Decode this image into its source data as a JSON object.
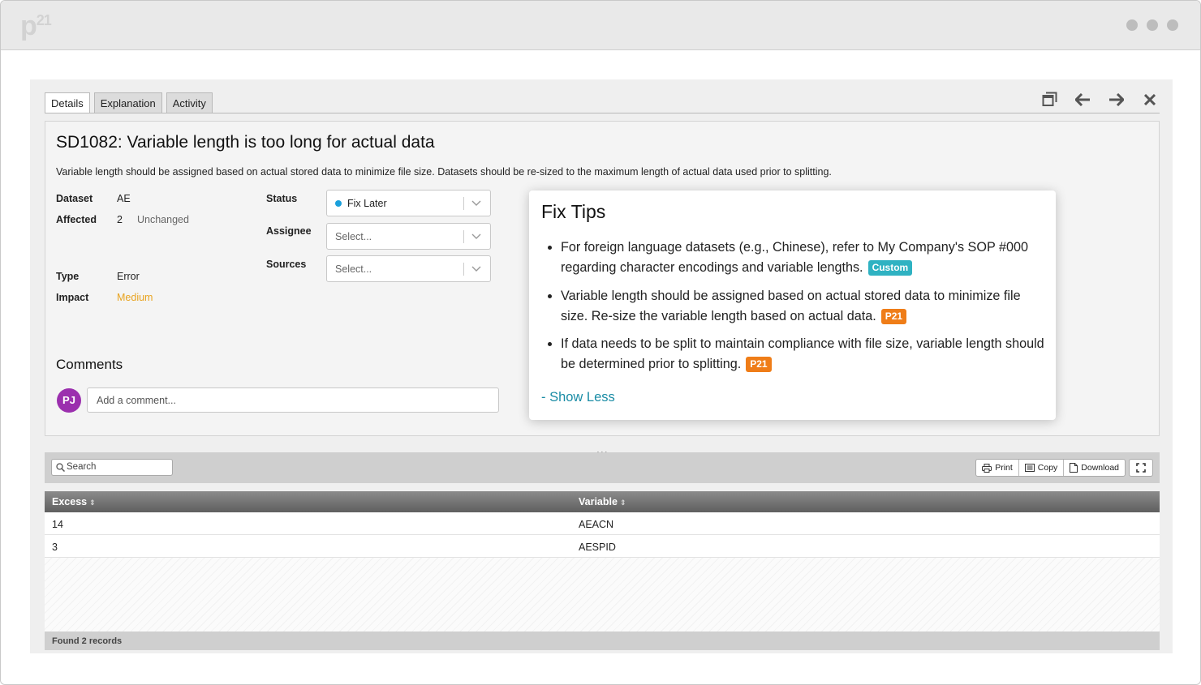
{
  "window": {
    "logo": "p",
    "logo_sup": "21"
  },
  "tabs": [
    {
      "label": "Details",
      "active": true
    },
    {
      "label": "Explanation",
      "active": false
    },
    {
      "label": "Activity",
      "active": false
    }
  ],
  "toolbar_icons": [
    "popout-icon",
    "arrow-left-icon",
    "arrow-right-icon",
    "close-icon"
  ],
  "rule": {
    "title": "SD1082: Variable length is too long for actual data",
    "description": "Variable length should be assigned based on actual stored data to minimize file size. Datasets should be re-sized to the maximum length of actual data used prior to splitting."
  },
  "fields": {
    "dataset_label": "Dataset",
    "dataset_value": "AE",
    "affected_label": "Affected",
    "affected_value": "2",
    "affected_note": "Unchanged",
    "type_label": "Type",
    "type_value": "Error",
    "impact_label": "Impact",
    "impact_value": "Medium",
    "status_label": "Status",
    "status_value": "Fix Later",
    "assignee_label": "Assignee",
    "assignee_placeholder": "Select...",
    "sources_label": "Sources",
    "sources_placeholder": "Select..."
  },
  "colors": {
    "status_dot": "#1aa0dc",
    "impact_medium": "#e8a31f",
    "badge_custom": "#2fb2c2",
    "badge_p21": "#ef7d18",
    "avatar": "#9b2fae",
    "link": "#1a8ca5"
  },
  "comments": {
    "title": "Comments",
    "avatar_initials": "PJ",
    "placeholder": "Add a comment..."
  },
  "fix_tips": {
    "title": "Fix Tips",
    "items": [
      {
        "text": "For foreign language datasets (e.g., Chinese), refer to My Company's SOP #000 regarding character encodings and variable lengths.",
        "badge": "Custom"
      },
      {
        "text": "Variable length should be assigned based on actual stored data to minimize file size. Re-size the variable length based on actual data.",
        "badge": "P21"
      },
      {
        "text": "If data needs to be split to maintain compliance with file size, variable length should be determined prior to splitting.",
        "badge": "P21"
      }
    ],
    "show_less": "- Show Less"
  },
  "splitter": "...",
  "grid": {
    "search_placeholder": "Search",
    "buttons": {
      "print": "Print",
      "copy": "Copy",
      "download": "Download"
    },
    "columns": [
      "Excess",
      "Variable"
    ],
    "rows": [
      [
        "14",
        "AEACN"
      ],
      [
        "3",
        "AESPID"
      ]
    ],
    "footer": "Found 2 records"
  }
}
